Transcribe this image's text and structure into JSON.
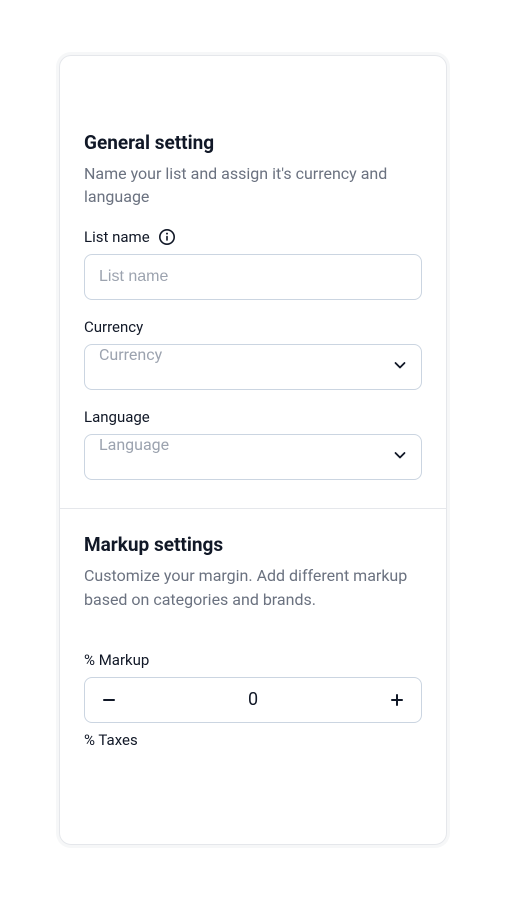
{
  "general": {
    "title": "General setting",
    "description": "Name your list and assign it's currency and language",
    "list_name": {
      "label": "List name",
      "placeholder": "List name",
      "value": ""
    },
    "currency": {
      "label": "Currency",
      "placeholder": "Currency"
    },
    "language": {
      "label": "Language",
      "placeholder": "Language"
    }
  },
  "markup": {
    "title": "Markup settings",
    "description": "Customize your margin. Add different markup based on categories and brands.",
    "percent_markup": {
      "label": "% Markup",
      "value": "0"
    },
    "percent_taxes": {
      "label": "% Taxes"
    }
  }
}
